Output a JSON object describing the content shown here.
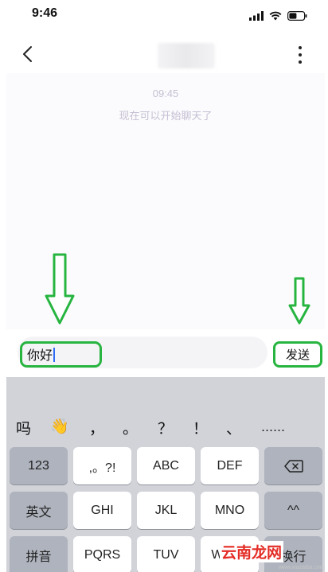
{
  "status_bar": {
    "time": "9:46"
  },
  "chat": {
    "timestamp": "09:45",
    "system_message": "现在可以开始聊天了"
  },
  "composer": {
    "input_value": "你好",
    "send_label": "发送"
  },
  "keyboard": {
    "candidates": [
      "吗",
      "👋",
      "，",
      "。",
      "？",
      "！",
      "、",
      "……"
    ],
    "rows": [
      [
        "123",
        ",。?!",
        "ABC",
        "DEF",
        "⌫"
      ],
      [
        "英文",
        "GHI",
        "JKL",
        "MNO",
        "^^"
      ],
      [
        "拼音",
        "PQRS",
        "TUV",
        "WXYZ",
        "换行"
      ]
    ]
  },
  "watermark": {
    "logo_text": "云南龙网",
    "url": "www.xiazaiba.com"
  },
  "colors": {
    "annotation_green": "#27b540",
    "caret_blue": "#2f6cf5",
    "system_text": "#c6bfd3"
  }
}
